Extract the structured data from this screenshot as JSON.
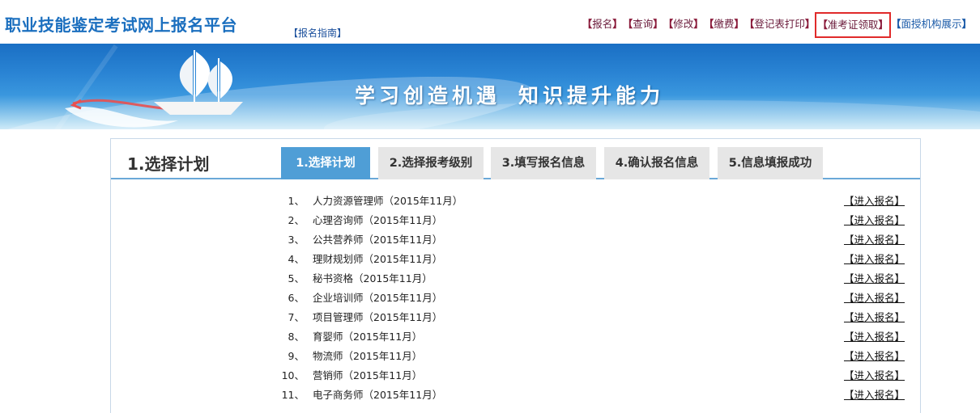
{
  "header": {
    "site_title": "职业技能鉴定考试网上报名平台",
    "guide_link": "【报名指南】",
    "nav": [
      {
        "label": "报名",
        "highlight": false,
        "blue": false
      },
      {
        "label": "查询",
        "highlight": false,
        "blue": false
      },
      {
        "label": "修改",
        "highlight": false,
        "blue": false
      },
      {
        "label": "缴费",
        "highlight": false,
        "blue": false
      },
      {
        "label": "登记表打印",
        "highlight": false,
        "blue": false
      },
      {
        "label": "准考证领取",
        "highlight": true,
        "blue": false
      },
      {
        "label": "面授机构展示",
        "highlight": false,
        "blue": true
      }
    ],
    "bracket_open": "【",
    "bracket_close": "】"
  },
  "banner": {
    "slogan_part1": "学习创造机遇",
    "slogan_part2": "知识提升能力"
  },
  "panel": {
    "heading": "1.选择计划",
    "steps": [
      {
        "label": "1.选择计划",
        "active": true
      },
      {
        "label": "2.选择报考级别",
        "active": false
      },
      {
        "label": "3.填写报名信息",
        "active": false
      },
      {
        "label": "4.确认报名信息",
        "active": false
      },
      {
        "label": "5.信息填报成功",
        "active": false
      }
    ],
    "enroll_label": "【进入报名】",
    "plans": [
      {
        "index": "1、",
        "name": "人力资源管理师（2015年11月）"
      },
      {
        "index": "2、",
        "name": "心理咨询师（2015年11月）"
      },
      {
        "index": "3、",
        "name": "公共营养师（2015年11月）"
      },
      {
        "index": "4、",
        "name": "理财规划师（2015年11月）"
      },
      {
        "index": "5、",
        "name": "秘书资格（2015年11月）"
      },
      {
        "index": "6、",
        "name": "企业培训师（2015年11月）"
      },
      {
        "index": "7、",
        "name": "项目管理师（2015年11月）"
      },
      {
        "index": "8、",
        "name": "育婴师（2015年11月）"
      },
      {
        "index": "9、",
        "name": "物流师（2015年11月）"
      },
      {
        "index": "10、",
        "name": "营销师（2015年11月）"
      },
      {
        "index": "11、",
        "name": "电子商务师（2015年11月）"
      }
    ]
  },
  "colors": {
    "title_blue": "#1b6fbf",
    "active_tab": "#4f9ed6",
    "inactive_tab": "#e6e6e6",
    "highlight_border": "#e02a2a"
  }
}
